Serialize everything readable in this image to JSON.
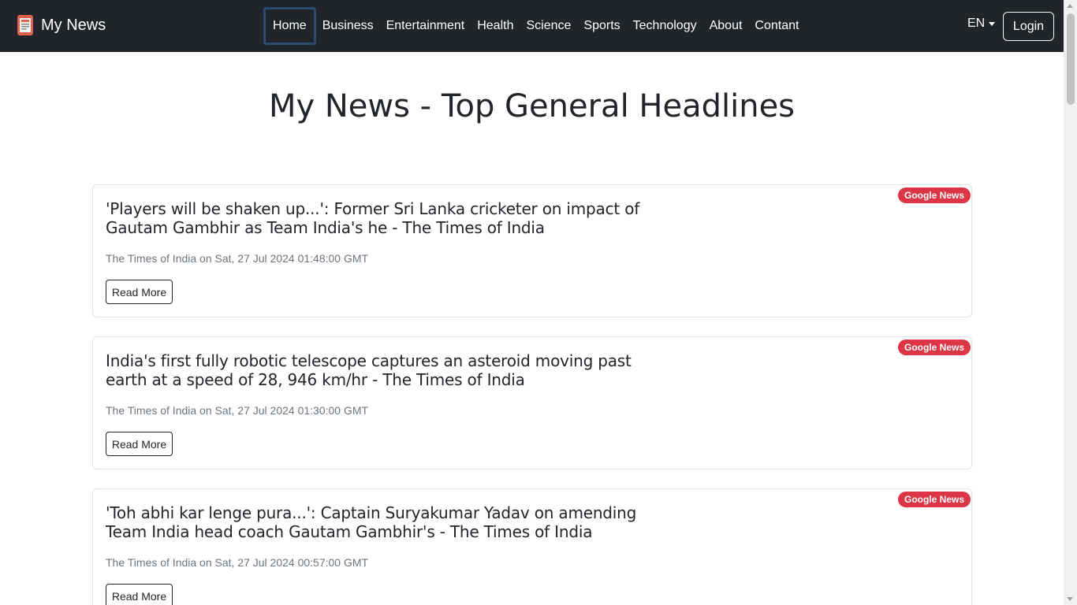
{
  "brand": {
    "name": "My News",
    "icon": "newspaper-icon"
  },
  "nav": {
    "items": [
      "Home",
      "Business",
      "Entertainment",
      "Health",
      "Science",
      "Sports",
      "Technology",
      "About",
      "Contant"
    ],
    "active": "Home"
  },
  "language": {
    "label": "EN"
  },
  "login": {
    "label": "Login"
  },
  "page": {
    "title": "My News - Top General Headlines"
  },
  "articles": [
    {
      "title": "'Players will be shaken up...': Former Sri Lanka cricketer on impact of Gautam Gambhir as Team India's he - The Times of India",
      "meta": "The Times of India on Sat, 27 Jul 2024 01:48:00 GMT",
      "source_badge": "Google News",
      "button": "Read More"
    },
    {
      "title": "India's first fully robotic telescope captures an asteroid moving past earth at a speed of 28, 946 km/hr - The Times of India",
      "meta": "The Times of India on Sat, 27 Jul 2024 01:30:00 GMT",
      "source_badge": "Google News",
      "button": "Read More"
    },
    {
      "title": "'Toh abhi kar lenge pura...': Captain Suryakumar Yadav on amending Team India head coach Gautam Gambhir's - The Times of India",
      "meta": "The Times of India on Sat, 27 Jul 2024 00:57:00 GMT",
      "source_badge": "Google News",
      "button": "Read More"
    }
  ],
  "colors": {
    "navbar": "#212529",
    "badge": "#dc3545",
    "active_outline": "#2b4a73"
  }
}
